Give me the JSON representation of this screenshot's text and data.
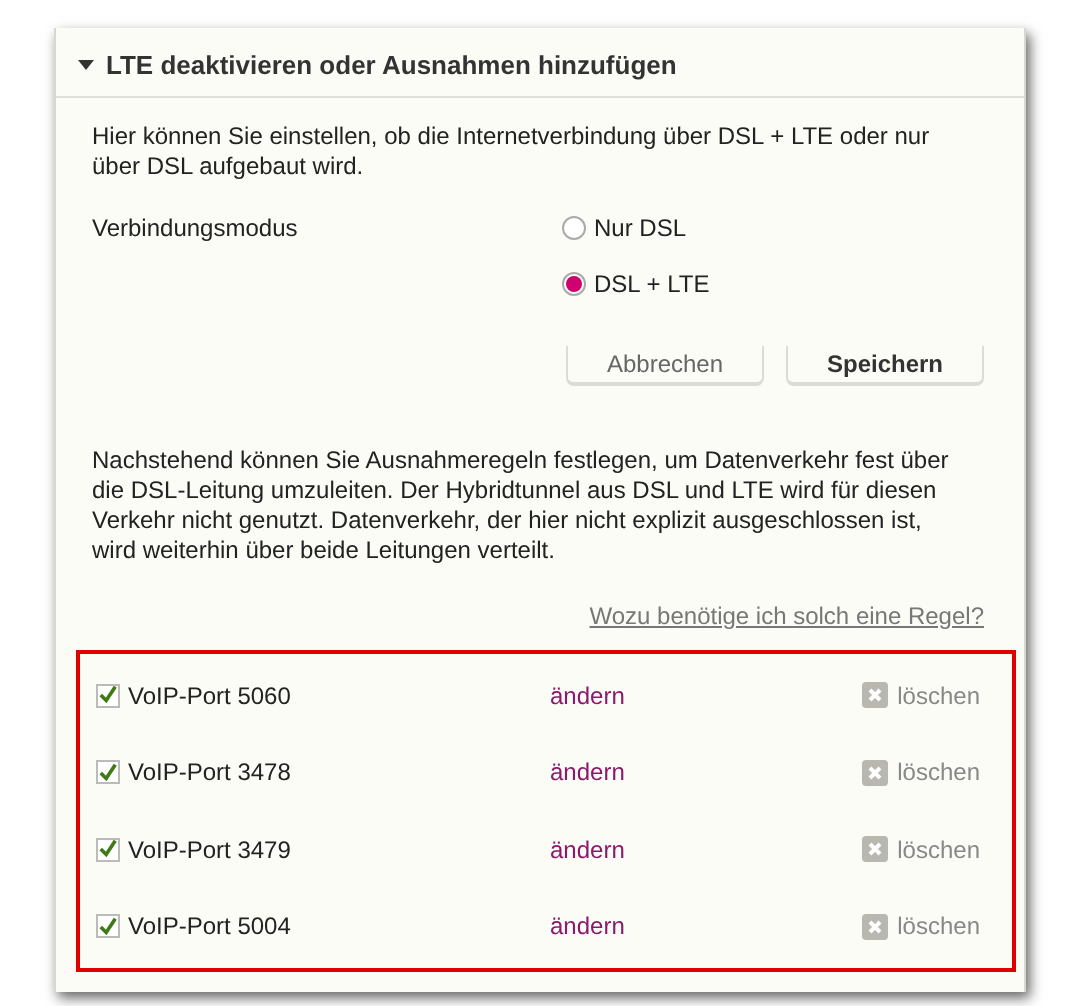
{
  "section": {
    "title": "LTE deaktivieren oder Ausnahmen hinzufügen",
    "expanded": true
  },
  "intro": "Hier können Sie einstellen, ob die Internetverbindung über DSL + LTE oder nur über DSL aufgebaut wird.",
  "mode": {
    "label": "Verbindungsmodus",
    "options": [
      {
        "label": "Nur DSL",
        "selected": false
      },
      {
        "label": "DSL + LTE",
        "selected": true
      }
    ]
  },
  "buttons": [
    {
      "label": "Abbrechen",
      "kind": "secondary"
    },
    {
      "label": "Speichern",
      "kind": "primary"
    }
  ],
  "exceptions_text": "Nachstehend können Sie Ausnahmeregeln festlegen, um Datenverkehr fest über die DSL-Leitung umzuleiten. Der Hybridtunnel aus DSL und LTE wird für diesen Verkehr nicht genutzt. Datenverkehr, der hier nicht explizit ausgeschlossen ist, wird weiterhin über beide Leitungen verteilt.",
  "help_link": "Wozu benötige ich solch eine Regel?",
  "rules": [
    {
      "name": "VoIP-Port 5060",
      "checked": true,
      "edit": "ändern",
      "delete": "löschen"
    },
    {
      "name": "VoIP-Port 3478",
      "checked": true,
      "edit": "ändern",
      "delete": "löschen"
    },
    {
      "name": "VoIP-Port 3479",
      "checked": true,
      "edit": "ändern",
      "delete": "löschen"
    },
    {
      "name": "VoIP-Port 5004",
      "checked": true,
      "edit": "ändern",
      "delete": "löschen"
    }
  ]
}
